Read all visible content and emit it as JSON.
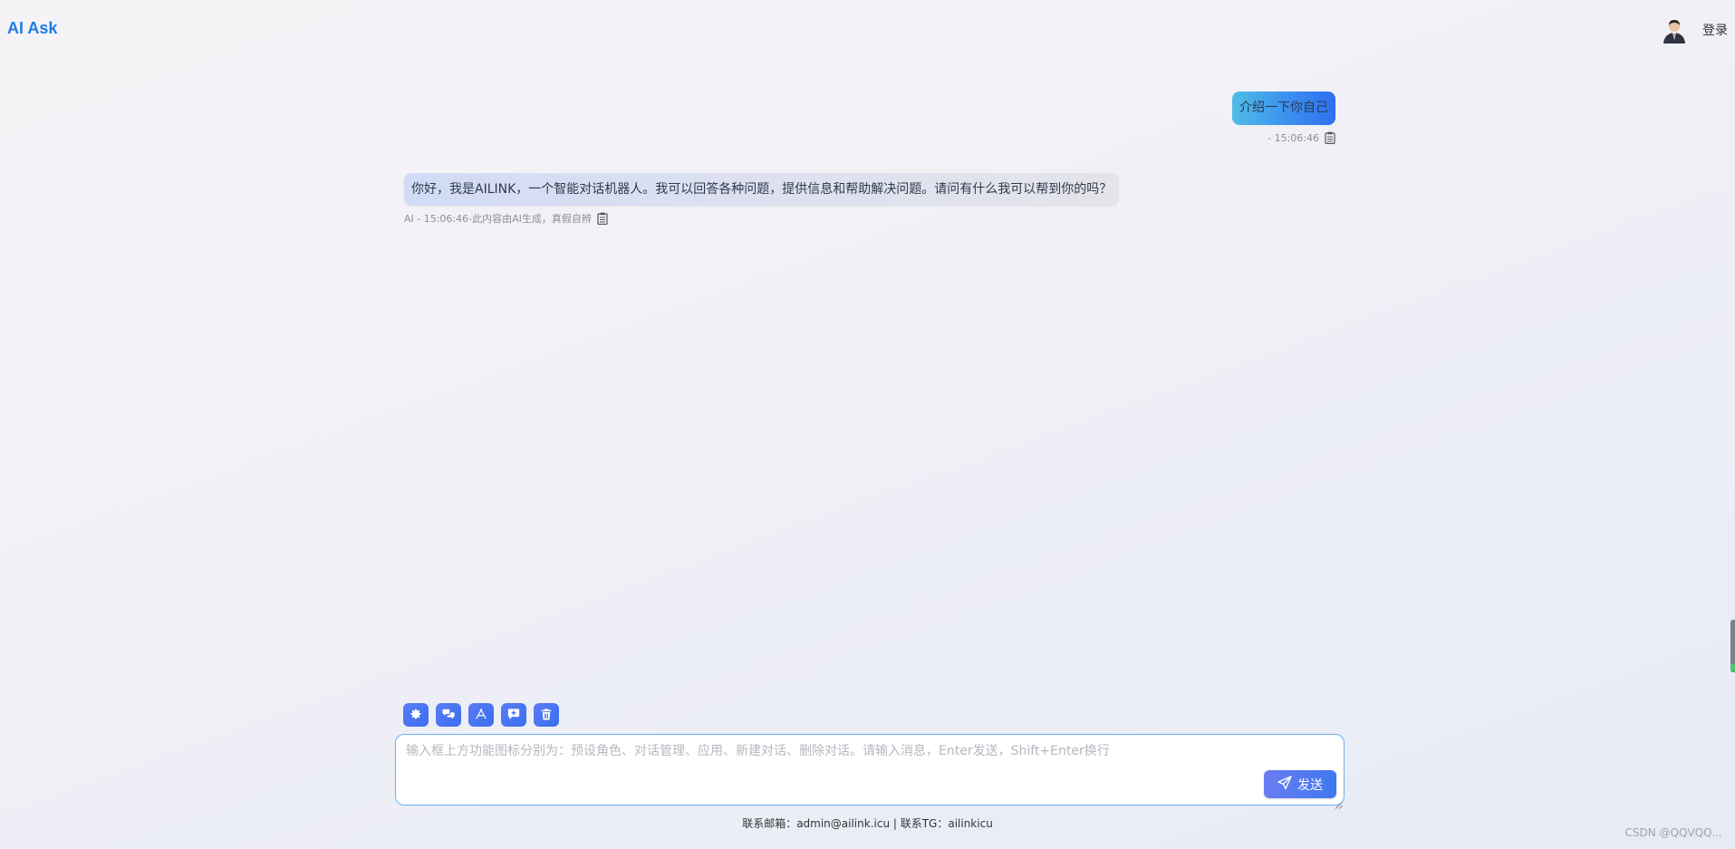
{
  "header": {
    "brand": "AI Ask",
    "login_label": "登录"
  },
  "chat": {
    "user_message": {
      "text": "介绍一下你自己",
      "meta": "- 15:06:46"
    },
    "ai_message": {
      "text": "你好，我是AILINK，一个智能对话机器人。我可以回答各种问题，提供信息和帮助解决问题。请问有什么我可以帮到你的吗？",
      "meta": "AI - 15:06:46-此内容由AI生成，真假自辨"
    }
  },
  "toolbar": {
    "tools": [
      {
        "icon": "gear-icon"
      },
      {
        "icon": "chat-bubbles-icon"
      },
      {
        "icon": "apps-icon"
      },
      {
        "icon": "new-chat-icon"
      },
      {
        "icon": "trash-icon"
      }
    ]
  },
  "input": {
    "placeholder": "输入框上方功能图标分别为：预设角色、对话管理、应用、新建对话、删除对话。请输入消息，Enter发送，Shift+Enter换行",
    "value": "",
    "send_label": "发送"
  },
  "footer": {
    "text": "联系邮箱：admin@ailink.icu | 联系TG：ailinkicu"
  },
  "watermark": "CSDN @QQVQQ...",
  "colors": {
    "brand": "#1f7be8",
    "accent": "#3f78ef",
    "input_border": "#6aaef4"
  }
}
